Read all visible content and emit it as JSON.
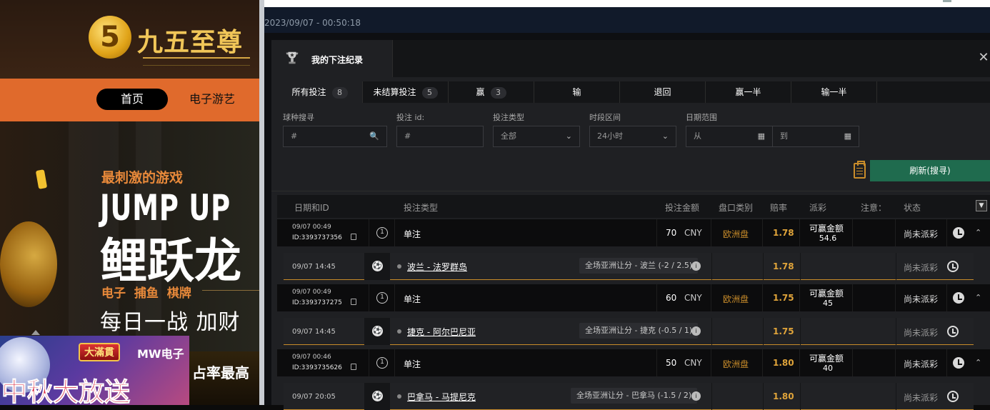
{
  "site": {
    "logo_char": "5",
    "brand": "九五至尊",
    "nav": {
      "home": "首页",
      "egames": "电子游艺"
    },
    "hero": {
      "subtitle": "最刺激的游戏",
      "title_en": "JUMP UP",
      "title_cn": "鲤跃龙",
      "categories": "电子 捕鱼 棋牌",
      "slogan": "每日一战 加财"
    },
    "bottom_text": "占率最高",
    "promo": {
      "badge": "大滿貫",
      "brand": "MW电子",
      "title": "中秋大放送"
    }
  },
  "timestamp": "2023/09/07 - 00:50:18",
  "panel": {
    "title": "我的下注纪录",
    "close": "✕",
    "tabs": [
      {
        "label": "所有投注",
        "count": "8"
      },
      {
        "label": "未结算投注",
        "count": "5"
      },
      {
        "label": "赢",
        "count": "3"
      },
      {
        "label": "输"
      },
      {
        "label": "退回"
      },
      {
        "label": "赢一半"
      },
      {
        "label": "输一半"
      }
    ],
    "filters": {
      "sport": {
        "label": "球种搜寻",
        "placeholder": "#"
      },
      "bet_id": {
        "label": "投注 id:",
        "placeholder": "#"
      },
      "bet_type": {
        "label": "投注类型",
        "value": "全部"
      },
      "period": {
        "label": "时段区间",
        "value": "24小时"
      },
      "date_range": {
        "label": "日期范围",
        "from": "从",
        "to": "到"
      }
    },
    "refresh": "刷新(搜寻)",
    "columns": {
      "date_id": "日期和ID",
      "type": "投注类型",
      "amount": "投注金额",
      "market": "盘口类别",
      "odds": "赔率",
      "payout": "派彩",
      "note": "注意：",
      "status": "状态"
    },
    "bets": [
      {
        "date": "09/07 00:49",
        "id": "ID:3393737356",
        "num": "1",
        "type": "单注",
        "amount": "70",
        "currency": "CNY",
        "market": "欧洲盘",
        "odds": "1.78",
        "win_label": "可赢金额",
        "win": "54.6",
        "status": "尚未派彩",
        "leg": {
          "date": "09/07 14:45",
          "match": "波兰 - 法罗群岛",
          "market": "全场亚洲让分 - 波兰 (-2 / 2.5)",
          "odds": "1.78",
          "status": "尚未派彩"
        }
      },
      {
        "date": "09/07 00:49",
        "id": "ID:3393737275",
        "num": "1",
        "type": "单注",
        "amount": "60",
        "currency": "CNY",
        "market": "欧洲盘",
        "odds": "1.75",
        "win_label": "可赢金额",
        "win": "45",
        "status": "尚未派彩",
        "leg": {
          "date": "09/07 14:45",
          "match": "捷克 - 阿尔巴尼亚",
          "market": "全场亚洲让分 - 捷克 (-0.5 / 1)",
          "odds": "1.75",
          "status": "尚未派彩"
        }
      },
      {
        "date": "09/07 00:46",
        "id": "ID:3393735626",
        "num": "1",
        "type": "单注",
        "amount": "50",
        "currency": "CNY",
        "market": "欧洲盘",
        "odds": "1.80",
        "win_label": "可赢金额",
        "win": "40",
        "status": "尚未派彩",
        "leg": {
          "date": "09/07 20:05",
          "match": "巴拿马 - 马提尼克",
          "market": "全场亚洲让分 - 巴拿马 (-1.5 / 2)",
          "odds": "1.80",
          "status": "尚未派彩"
        }
      }
    ]
  }
}
